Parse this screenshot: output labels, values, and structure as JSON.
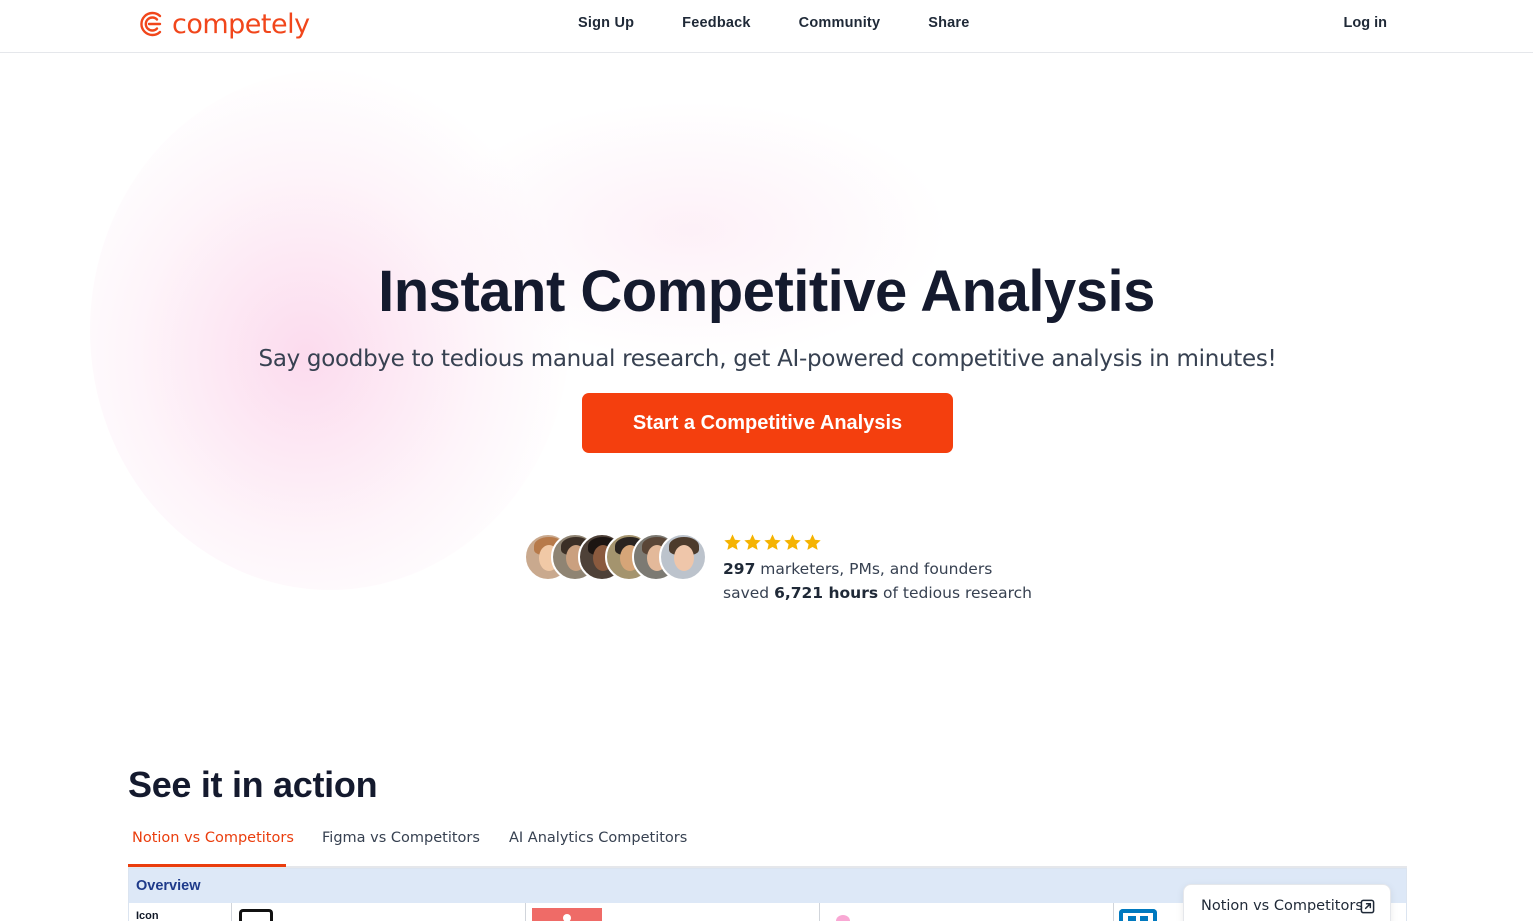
{
  "header": {
    "logo_text": "competely",
    "brand_color": "#f1461b",
    "nav": [
      {
        "label": "Sign Up"
      },
      {
        "label": "Feedback"
      },
      {
        "label": "Community"
      },
      {
        "label": "Share"
      }
    ],
    "login_label": "Log in"
  },
  "hero": {
    "title": "Instant Competitive Analysis",
    "subtitle": "Say goodbye to tedious manual research, get AI-powered competitive analysis in minutes!",
    "cta_label": "Start a Competitive Analysis",
    "cta_color": "#f43f0e"
  },
  "social_proof": {
    "avatar_count": 6,
    "star_rating": 5,
    "star_color": "#f5b301",
    "user_count": "297",
    "line1_rest": " marketers, PMs, and founders",
    "line2_prefix": "saved ",
    "hours": "6,721 hours",
    "line2_suffix": " of tedious research"
  },
  "demo": {
    "title": "See it in action",
    "tabs": [
      {
        "label": "Notion vs Competitors",
        "active": true
      },
      {
        "label": "Figma vs Competitors",
        "active": false
      },
      {
        "label": "AI Analytics Competitors",
        "active": false
      }
    ],
    "table": {
      "section_label": "Overview",
      "row_label": "Icon"
    },
    "floating_card_label": "Notion vs Competitors"
  }
}
